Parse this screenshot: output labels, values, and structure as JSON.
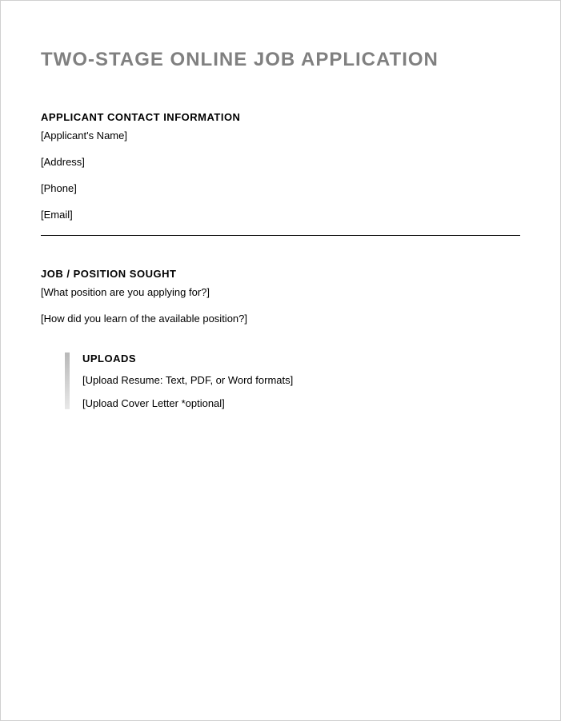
{
  "title": "TWO-STAGE ONLINE JOB APPLICATION",
  "sections": {
    "contact": {
      "heading": "APPLICANT CONTACT INFORMATION",
      "fields": [
        "[Applicant's Name]",
        "[Address]",
        "[Phone]",
        "[Email]"
      ]
    },
    "job": {
      "heading": "JOB / POSITION SOUGHT",
      "fields": [
        "[What position are you applying for?]",
        "[How did you learn of the available position?]"
      ]
    },
    "uploads": {
      "heading": "UPLOADS",
      "fields": [
        "[Upload Resume: Text, PDF, or Word formats]",
        "[Upload Cover Letter *optional]"
      ]
    }
  }
}
